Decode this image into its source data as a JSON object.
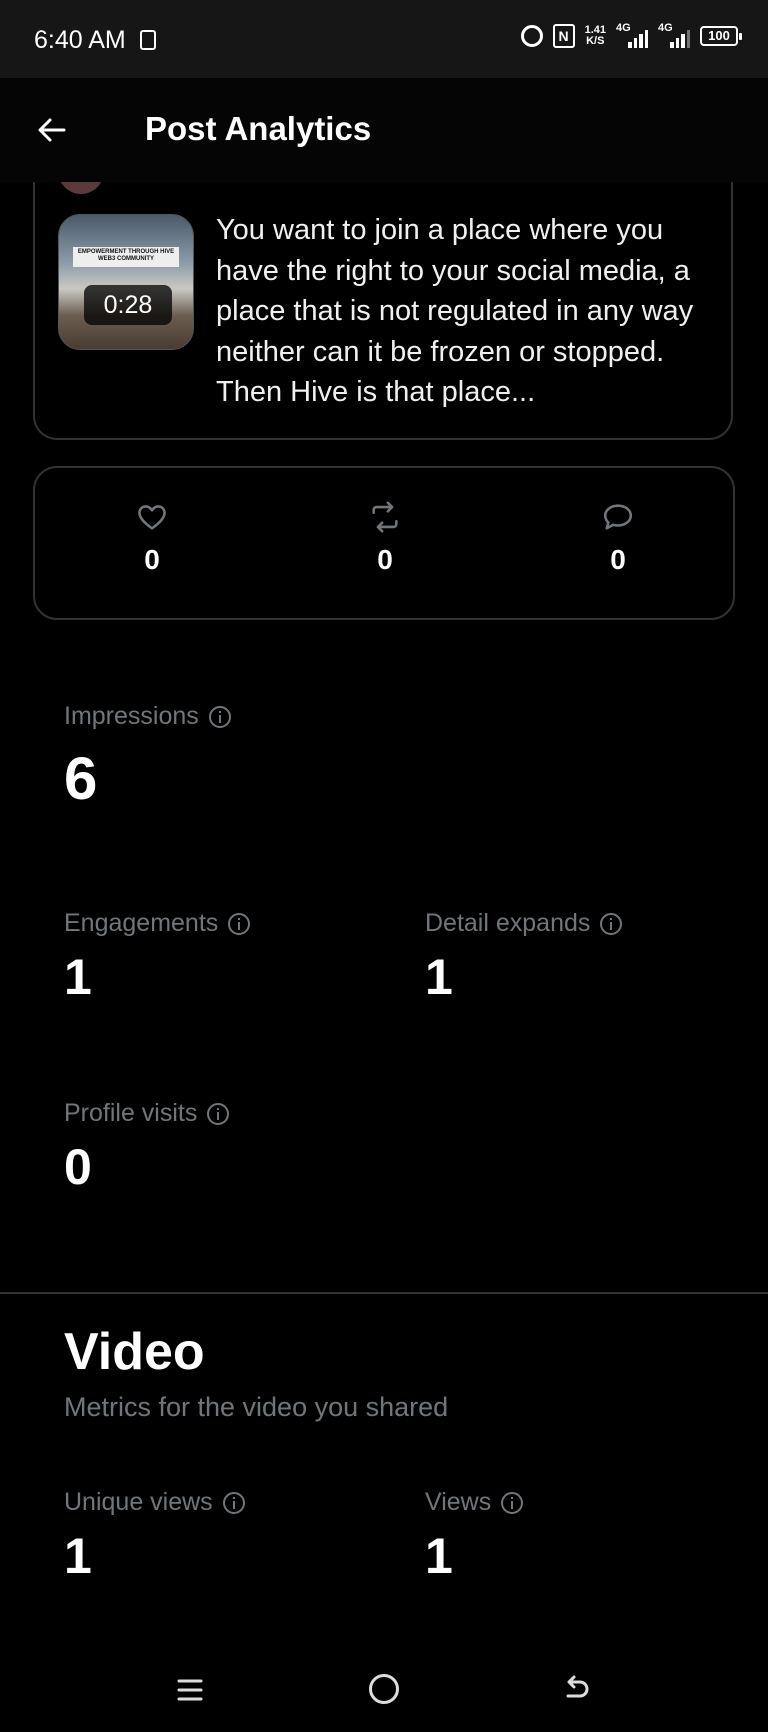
{
  "status_bar": {
    "time": "6:40 AM",
    "net_speed_value": "1.41",
    "net_speed_unit": "K/S",
    "signal1_label": "4G",
    "signal2_label": "4G",
    "battery": "100"
  },
  "header": {
    "title": "Post Analytics"
  },
  "post": {
    "thumbnail_banner": "EMPOWERMENT THROUGH HIVE WEB3 COMMUNITY",
    "video_duration": "0:28",
    "text": "You want to join a place where you have the right to your social media, a place that is not regulated in any way neither can it be frozen or stopped. Then Hive is that place..."
  },
  "engagement": {
    "likes": "0",
    "reposts": "0",
    "replies": "0"
  },
  "metrics": {
    "impressions_label": "Impressions",
    "impressions_value": "6",
    "engagements_label": "Engagements",
    "engagements_value": "1",
    "detail_expands_label": "Detail expands",
    "detail_expands_value": "1",
    "profile_visits_label": "Profile visits",
    "profile_visits_value": "0"
  },
  "video_section": {
    "title": "Video",
    "subtitle": "Metrics for the video you shared",
    "unique_views_label": "Unique views",
    "unique_views_value": "1",
    "views_label": "Views",
    "views_value": "1"
  }
}
